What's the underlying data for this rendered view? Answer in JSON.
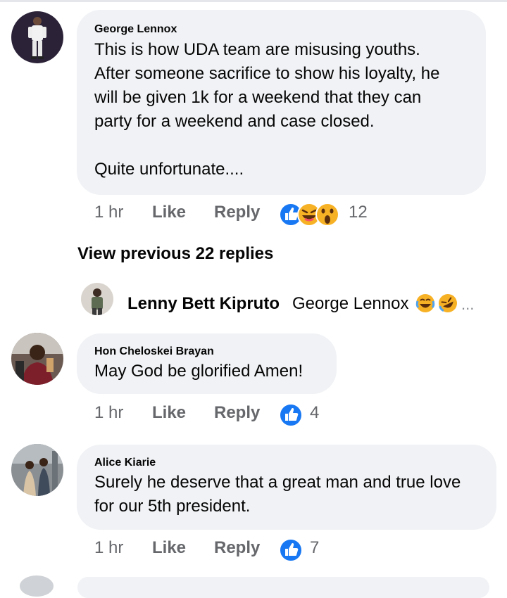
{
  "comments": [
    {
      "author": "George Lennox",
      "text": "This is how UDA team are misusing youths.\nAfter someone sacrifice to show his loyalty, he\nwill be given 1k for a weekend that they can\nparty for a weekend and case closed.\n\nQuite unfortunate....",
      "time": "1 hr",
      "like_label": "Like",
      "reply_label": "Reply",
      "reactions": [
        "like-icon",
        "laughing-emoji-icon",
        "wow-emoji-icon"
      ],
      "reaction_count": "12"
    },
    {
      "author": "Hon Cheloskei Brayan",
      "text": "May God be glorified Amen!",
      "time": "1 hr",
      "like_label": "Like",
      "reply_label": "Reply",
      "reactions": [
        "like-icon"
      ],
      "reaction_count": "4"
    },
    {
      "author": "Alice Kiarie",
      "text": "Surely he deserve that a great man and true love\nfor our 5th president.",
      "time": "1 hr",
      "like_label": "Like",
      "reply_label": "Reply",
      "reactions": [
        "like-icon"
      ],
      "reaction_count": "7"
    }
  ],
  "view_previous": "View previous 22 replies",
  "reply_preview": {
    "author": "Lenny Bett Kipruto",
    "text": "George Lennox",
    "emojis": [
      "tears-of-joy-emoji-icon",
      "rolling-laughing-emoji-icon"
    ],
    "more": "..."
  },
  "colors": {
    "bubble": "#f0f2f5",
    "like_blue": "#1877f2",
    "muted_text": "#65676b",
    "emoji_yellow": "#f7b125"
  }
}
